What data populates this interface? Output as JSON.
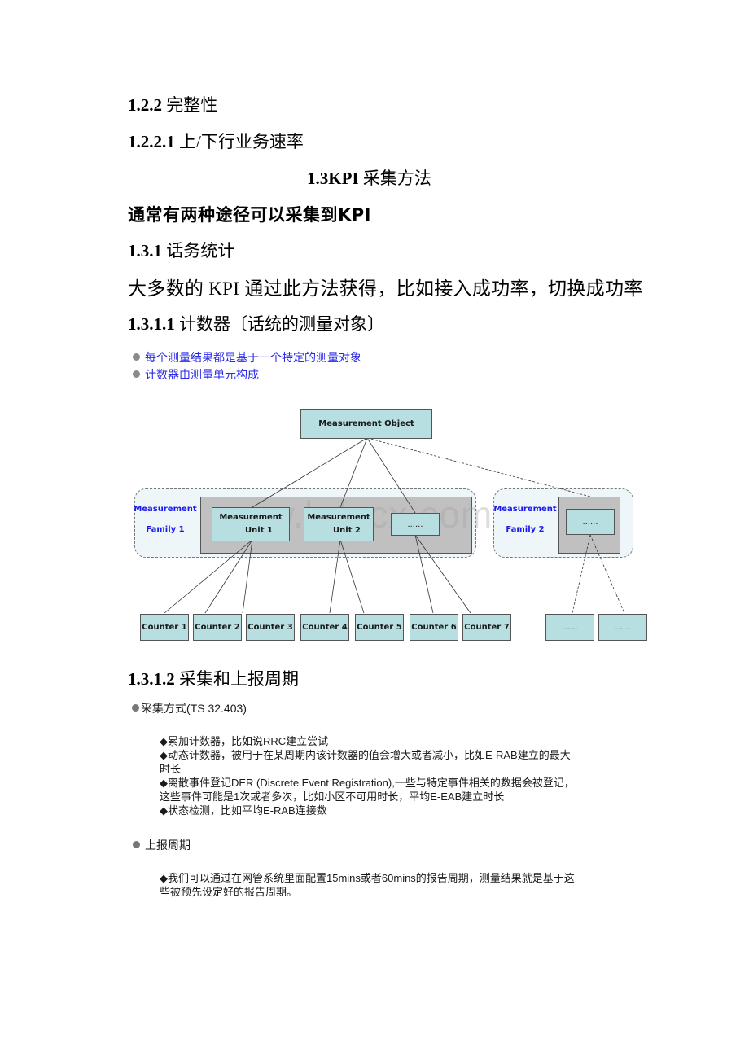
{
  "headings": {
    "h122": {
      "num": "1.2.2",
      "text": "完整性"
    },
    "h1221": {
      "num": "1.2.2.1",
      "text": "上/下行业务速率"
    },
    "h13": {
      "num": "1.3KPI",
      "text": "采集方法"
    },
    "intro": "通常有两种途径可以采集到KPI",
    "h131": {
      "num": "1.3.1",
      "text": "话务统计"
    },
    "body131": "大多数的 KPI 通过此方法获得，比如接入成功率，切换成功率",
    "h1311": {
      "num": "1.3.1.1",
      "text": "计数器〔话统的测量对象〕"
    },
    "h1312": {
      "num": "1.3.1.2",
      "text": "采集和上报周期"
    }
  },
  "blue_bullets": [
    "每个测量结果都是基于一个特定的测量对象",
    "计数器由测量单元构成"
  ],
  "diagram": {
    "object": "Measurement Object",
    "family1": {
      "line1": "Measurement",
      "line2": "Family 1"
    },
    "family2": {
      "line1": "Measurement",
      "line2": "Family 2"
    },
    "unit1": {
      "line1": "Measurement",
      "line2": "Unit 1"
    },
    "unit2": {
      "line1": "Measurement",
      "line2": "Unit 2"
    },
    "unit_more": "......",
    "unit_f2": "......",
    "counters": [
      "Counter 1",
      "Counter 2",
      "Counter 3",
      "Counter 4",
      "Counter 5",
      "Counter 6",
      "Counter 7"
    ],
    "counters_more": [
      "......",
      "......"
    ],
    "watermark": "www.bdocx.com",
    "colors": {
      "box_fill": "#b7dfe2",
      "unit_group": "#c0c0c0",
      "family_bg": "#eef6f9",
      "family_label": "#1a1aee"
    }
  },
  "collection": {
    "method_title": "采集方式(TS 32.403)",
    "methods": [
      "◆累加计数器，比如说RRC建立尝试",
      "◆动态计数器，被用于在某周期内该计数器的值会增大或者减小，比如E-RAB建立的最大",
      "时长",
      "◆离散事件登记DER (Discrete Event Registration),一些与特定事件相关的数据会被登记，",
      "这些事件可能是1次或者多次，比如小区不可用时长，平均E-EAB建立时长",
      "◆状态检测，比如平均E-RAB连接数"
    ],
    "report_title": "上报周期",
    "report_lines": [
      "◆我们可以通过在网管系统里面配置15mins或者60mins的报告周期，测量结果就是基于这",
      "些被预先设定好的报告周期。"
    ]
  }
}
